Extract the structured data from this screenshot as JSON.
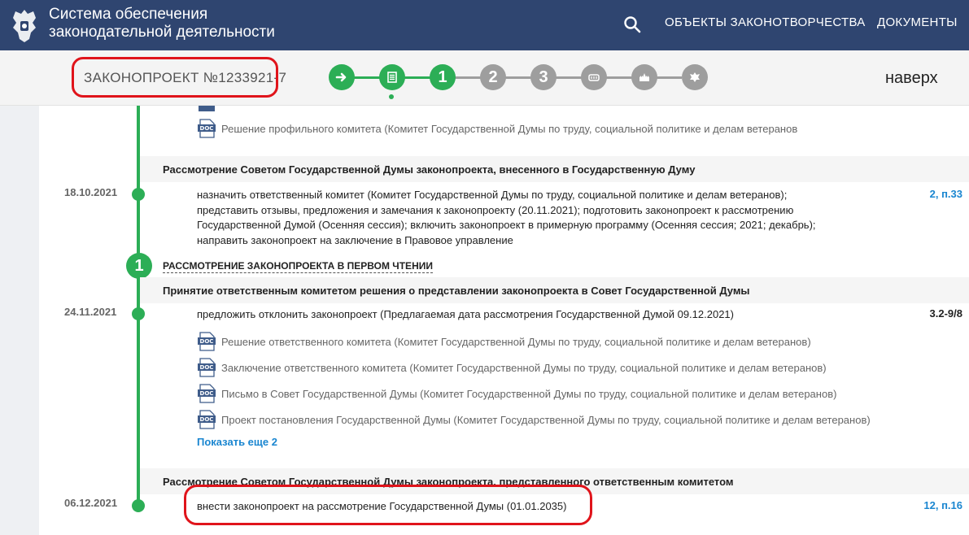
{
  "header": {
    "app_title_line1": "Система обеспечения",
    "app_title_line2": "законодательной деятельности",
    "nav": [
      "ОБЪЕКТЫ ЗАКОНОТВОРЧЕСТВА",
      "ДОКУМЕНТЫ"
    ],
    "icons": {
      "emblem": "coat-of-arms-icon",
      "search": "search-icon"
    }
  },
  "stagebar": {
    "bill_number": "ЗАКОНОПРОЕКТ №1233921-7",
    "stages": [
      {
        "label": "",
        "icon": "arrow-right-icon",
        "state": "done"
      },
      {
        "label": "",
        "icon": "document-list-icon",
        "state": "active"
      },
      {
        "label": "1",
        "icon": "",
        "state": "done"
      },
      {
        "label": "2",
        "icon": "",
        "state": "pending"
      },
      {
        "label": "3",
        "icon": "",
        "state": "pending"
      },
      {
        "label": "",
        "icon": "parliament-icon",
        "state": "pending"
      },
      {
        "label": "",
        "icon": "kremlin-icon",
        "state": "pending"
      },
      {
        "label": "",
        "icon": "eagle-icon",
        "state": "pending"
      }
    ],
    "up_label": "наверх"
  },
  "colors": {
    "header_bg": "#2f4570",
    "accent_green": "#2cae56",
    "pending_gray": "#9e9e9e",
    "link_blue": "#1a86d0",
    "highlight_red": "#e0141b"
  },
  "content": {
    "top_doc": "Решение профильного комитета (Комитет Государственной Думы по труду, социальной политике и делам ветеранов",
    "section1": {
      "title": "Рассмотрение Советом Государственной Думы законопроекта, внесенного в Государственную Думу",
      "date": "18.10.2021",
      "lines": [
        "назначить ответственный комитет (Комитет Государственной Думы по труду, социальной политике и делам ветеранов);",
        "представить отзывы, предложения и замечания к законопроекту (20.11.2021); подготовить законопроект к рассмотрению",
        "Государственной Думой (Осенняя сессия); включить законопроект в примерную программу (Осенняя сессия; 2021; декабрь);",
        "направить законопроект на заключение в Правовое управление"
      ],
      "ref": "2, п.33"
    },
    "stage1": {
      "number": "1",
      "title": "РАССМОТРЕНИЕ ЗАКОНОПРОЕКТА В ПЕРВОМ ЧТЕНИИ"
    },
    "section2": {
      "title": "Принятие ответственным комитетом решения о представлении законопроекта в Совет Государственной Думы",
      "date": "24.11.2021",
      "text": "предложить отклонить законопроект (Предлагаемая дата рассмотрения Государственной Думой 09.12.2021)",
      "ref": "3.2-9/8",
      "docs": [
        "Решение ответственного комитета (Комитет Государственной Думы по труду, социальной политике и делам ветеранов)",
        "Заключение ответственного комитета (Комитет Государственной Думы по труду, социальной политике и делам ветеранов)",
        "Письмо в Совет Государственной Думы (Комитет Государственной Думы по труду, социальной политике и делам ветеранов)",
        "Проект постановления Государственной Думы (Комитет Государственной Думы по труду, социальной политике и делам ветеранов)"
      ],
      "show_more": "Показать еще 2"
    },
    "section3": {
      "title": "Рассмотрение Советом Государственной Думы законопроекта, представленного ответственным комитетом",
      "date": "06.12.2021",
      "text": "внести законопроект на рассмотрение Государственной Думы (01.01.2035)",
      "ref": "12, п.16"
    },
    "doc_icon_label": "DOC"
  }
}
